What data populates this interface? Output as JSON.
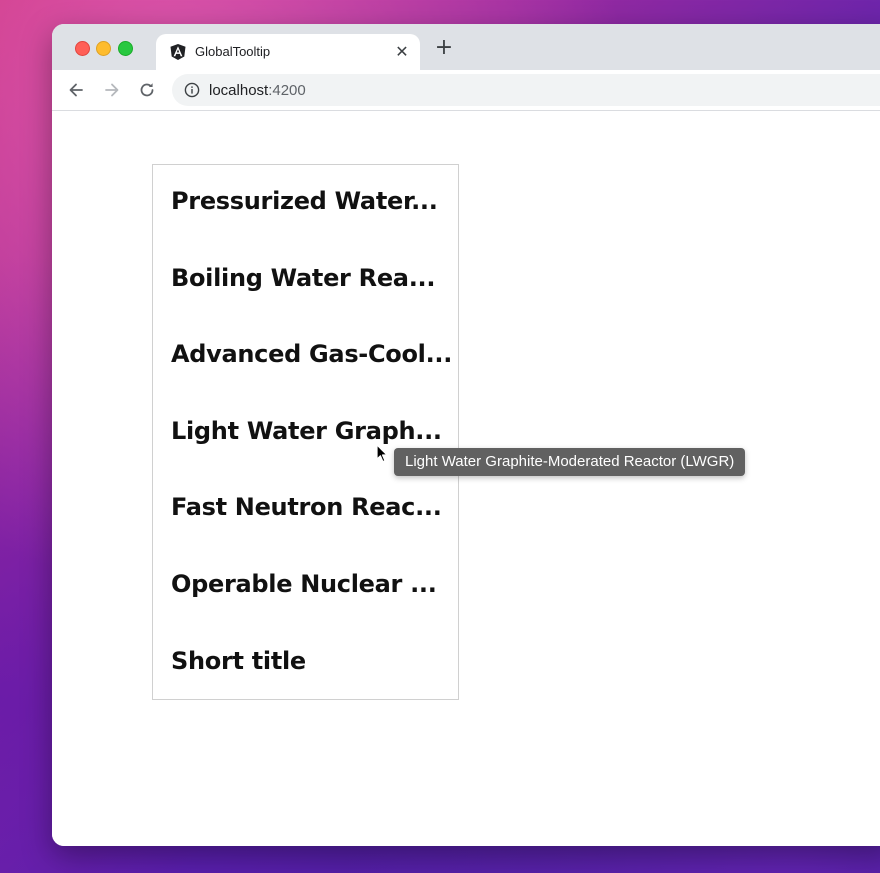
{
  "browser": {
    "tab_title": "GlobalTooltip",
    "tab_close": "✕",
    "new_tab": "+",
    "url_host": "localhost",
    "url_port": ":4200"
  },
  "list": {
    "items": [
      "Pressurized Water...",
      "Boiling Water Rea...",
      "Advanced Gas-Cool...",
      "Light Water Graph...",
      "Fast Neutron Reac...",
      "Operable Nuclear ...",
      "Short title"
    ]
  },
  "tooltip": {
    "text": "Light Water Graphite-Moderated Reactor (LWGR)"
  },
  "icons": {
    "tab_favicon": "angular-logo-icon",
    "back": "arrow-left-icon",
    "forward": "arrow-right-icon",
    "reload": "reload-icon",
    "site_info": "info-icon",
    "pointer": "mouse-cursor-icon"
  },
  "colors": {
    "tooltip_bg": "#616161",
    "card_border": "#d0d0d0",
    "tabstrip_bg": "#dee1e6",
    "omnibox_bg": "#f1f3f4"
  }
}
